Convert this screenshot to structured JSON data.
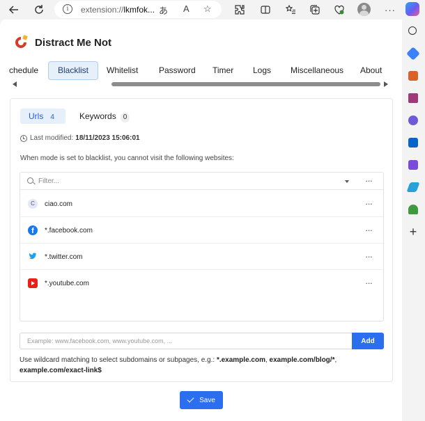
{
  "browser": {
    "url_prefix": "extension://",
    "url_rest": "lkmfok...",
    "icons": [
      "back-icon",
      "refresh-icon",
      "info-icon",
      "read-aloud-icon",
      "text-size-icon",
      "favorite-star-icon",
      "extensions-icon",
      "split-screen-icon",
      "favorites-icon",
      "collections-icon",
      "browser-essentials-icon",
      "profile-avatar",
      "more-icon",
      "copilot-icon"
    ]
  },
  "sidebar_icons": [
    "search-icon",
    "tag-icon",
    "briefcase-icon",
    "chess-icon",
    "circle-app-icon",
    "outlook-icon",
    "edit-app-icon",
    "send-icon",
    "tree-icon",
    "add-icon"
  ],
  "app": {
    "title": "Distract Me Not"
  },
  "tabs": [
    {
      "label": "chedule"
    },
    {
      "label": "Blacklist"
    },
    {
      "label": "Whitelist"
    },
    {
      "label": "Password"
    },
    {
      "label": "Timer"
    },
    {
      "label": "Logs"
    },
    {
      "label": "Miscellaneous"
    },
    {
      "label": "About"
    }
  ],
  "subtabs": [
    {
      "label": "Urls",
      "count": "4"
    },
    {
      "label": "Keywords",
      "count": "0"
    }
  ],
  "modified": {
    "label": "Last modified:",
    "value": "18/11/2023 15:06:01"
  },
  "notice": "When mode is set to blacklist, you cannot visit the following websites:",
  "filter": {
    "placeholder": "Filter..."
  },
  "sites": [
    {
      "favicon": "C",
      "label": "ciao.com"
    },
    {
      "favicon": "f",
      "label": "*.facebook.com"
    },
    {
      "favicon": "🐦",
      "label": "*.twitter.com"
    },
    {
      "favicon": "",
      "label": "*.youtube.com"
    }
  ],
  "add": {
    "placeholder": "Example: www.facebook.com, www.youtube.com, ...",
    "button": "Add"
  },
  "hint": {
    "text": "Use wildcard matching to select subdomains or subpages, e.g.: ",
    "ex1": "*.example.com",
    "sep": ", ",
    "ex2": "example.com/blog/*",
    "sep2": ",",
    "ex3": "example.com/exact-link$"
  },
  "save": {
    "label": "Save"
  },
  "colors": {
    "accent": "#2b6ff0",
    "active_tab_bg": "#e6f0fb"
  }
}
